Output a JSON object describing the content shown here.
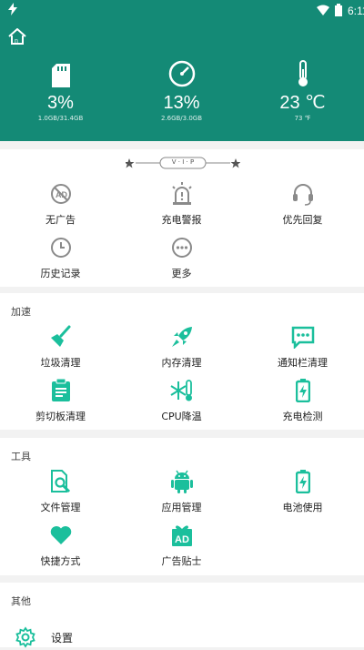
{
  "status_bar": {
    "time": "6:11"
  },
  "stats": [
    {
      "icon": "sd-card-icon",
      "value": "3%",
      "detail": "1.0GB/31.4GB"
    },
    {
      "icon": "speedometer-icon",
      "value": "13%",
      "detail": "2.6GB/3.0GB"
    },
    {
      "icon": "thermometer-icon",
      "value": "23 ℃",
      "detail": "73 ℉"
    }
  ],
  "vip": {
    "label": "V · I · P"
  },
  "vip_items": [
    {
      "label": "无广告",
      "icon": "no-ads-icon"
    },
    {
      "label": "充电警报",
      "icon": "alarm-light-icon"
    },
    {
      "label": "优先回复",
      "icon": "headset-icon"
    },
    {
      "label": "历史记录",
      "icon": "clock-icon"
    },
    {
      "label": "更多",
      "icon": "more-icon"
    }
  ],
  "sections": [
    {
      "title": "加速",
      "items": [
        {
          "label": "垃圾清理",
          "icon": "broom-icon"
        },
        {
          "label": "内存清理",
          "icon": "rocket-icon"
        },
        {
          "label": "通知栏清理",
          "icon": "message-icon"
        },
        {
          "label": "剪切板清理",
          "icon": "clipboard-icon"
        },
        {
          "label": "CPU降温",
          "icon": "snowflake-thermometer-icon"
        },
        {
          "label": "充电检测",
          "icon": "battery-charging-icon"
        }
      ]
    },
    {
      "title": "工具",
      "items": [
        {
          "label": "文件管理",
          "icon": "file-search-icon"
        },
        {
          "label": "应用管理",
          "icon": "android-icon"
        },
        {
          "label": "电池使用",
          "icon": "battery-icon"
        },
        {
          "label": "快捷方式",
          "icon": "heart-icon"
        },
        {
          "label": "广告贴士",
          "icon": "ad-gift-icon"
        }
      ]
    },
    {
      "title": "其他",
      "items": [
        {
          "label": "设置",
          "icon": "gear-icon"
        }
      ]
    }
  ],
  "colors": {
    "brand": "#148a76",
    "accent": "#1bbf9c",
    "vip_icon": "#8a8a8a"
  }
}
